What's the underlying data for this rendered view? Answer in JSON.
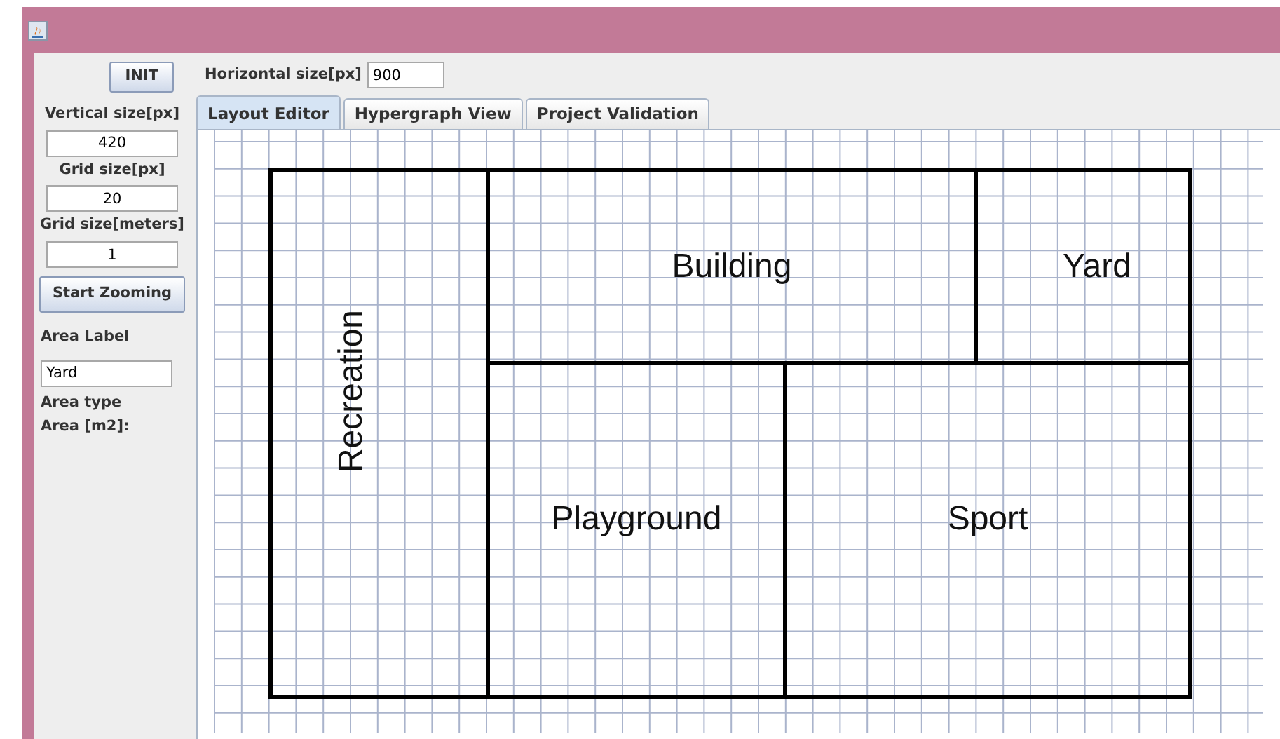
{
  "toolbar": {
    "init_button": "INIT",
    "horizontal_label": "Horizontal size[px]",
    "horizontal_value": "900"
  },
  "sidebar": {
    "fields": [
      {
        "label": "Vertical size[px]",
        "value": "420"
      },
      {
        "label": "Grid size[px]",
        "value": "20"
      },
      {
        "label": "Grid size[meters]",
        "value": "1"
      }
    ],
    "zoom_button": "Start Zooming",
    "area_label": "Area Label",
    "area_label_value": "Yard",
    "area_type": "Area type",
    "area_m2": "Area [m2]:"
  },
  "tabs": [
    {
      "label": "Layout Editor",
      "selected": true
    },
    {
      "label": "Hypergraph View",
      "selected": false
    },
    {
      "label": "Project Validation",
      "selected": false
    }
  ],
  "areas": [
    {
      "label": "Recreation",
      "kind": "vertical"
    },
    {
      "label": "Building",
      "kind": "horizontal"
    },
    {
      "label": "Yard",
      "kind": "horizontal"
    },
    {
      "label": "Playground",
      "kind": "horizontal"
    },
    {
      "label": "Sport",
      "kind": "horizontal"
    }
  ]
}
